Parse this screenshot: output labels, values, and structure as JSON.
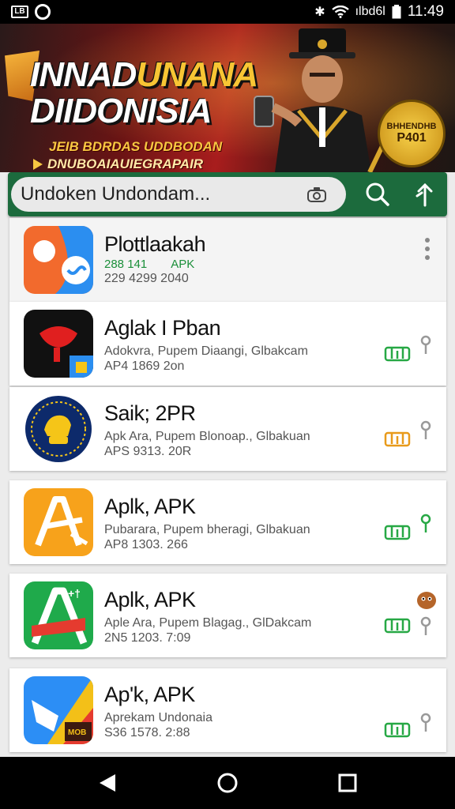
{
  "status_bar": {
    "left_icons": [
      "notification-box-icon",
      "circle-icon"
    ],
    "left_box_text": "LB",
    "carrier_text": "ılbd6l",
    "time": "11:49"
  },
  "banner": {
    "title_line1_white": "INNAD",
    "title_line1_gold": "UNANA",
    "title_line2": "DIIDONISIA",
    "subtitle": "JEIB BDRDAS UDDBODAN",
    "subtitle2": "DNUBOAIAUIEGRAPAIR",
    "badge_line1": "BHHENDHB",
    "badge_line2": "P401"
  },
  "search": {
    "placeholder": "Undoken Undondam..."
  },
  "apps": [
    {
      "title": "Plottlaakah",
      "meta_green": "288 141",
      "meta_apk": "APK",
      "meta": "229 4299 2040",
      "colors": [
        "#f26a2d",
        "#2b8ef0",
        "#fff"
      ]
    },
    {
      "title": "Aglak I Pban",
      "desc": "Adokvra, Pupem Diaangi, Glbakcam",
      "meta": "AP4 1869  2on",
      "colors": [
        "#111",
        "#e01f1f",
        "#fff"
      ]
    },
    {
      "title": "Saik; 2PR",
      "desc": "Apk Ara, Pupem Blonoap., Glbakuan",
      "meta": "APS 9313. 20R",
      "colors": [
        "#0d2a6b",
        "#f5c518",
        "#fff"
      ]
    },
    {
      "title": "Aplk, APK",
      "desc": "Pubarara, Pupem bheragi, Glbakuan",
      "meta": "AP8 1303. 266",
      "colors": [
        "#f7a21b",
        "#f26a1b",
        "#fff"
      ]
    },
    {
      "title": "Aplk, APK",
      "desc": "Aple Ara, Pupem Blagag., GlDakcam",
      "meta": "2N5 1203. 7:09",
      "colors": [
        "#1faa4b",
        "#e53b2f",
        "#fff"
      ]
    },
    {
      "title": "Ap'k, APK",
      "desc": "Aprekam Undonaia",
      "meta": "S36 1578. 2:88",
      "colors": [
        "#2c8ef5",
        "#f3c018",
        "#e53b2f"
      ]
    }
  ],
  "nav": {
    "back": "back-icon",
    "home": "home-icon",
    "recents": "recents-icon"
  }
}
